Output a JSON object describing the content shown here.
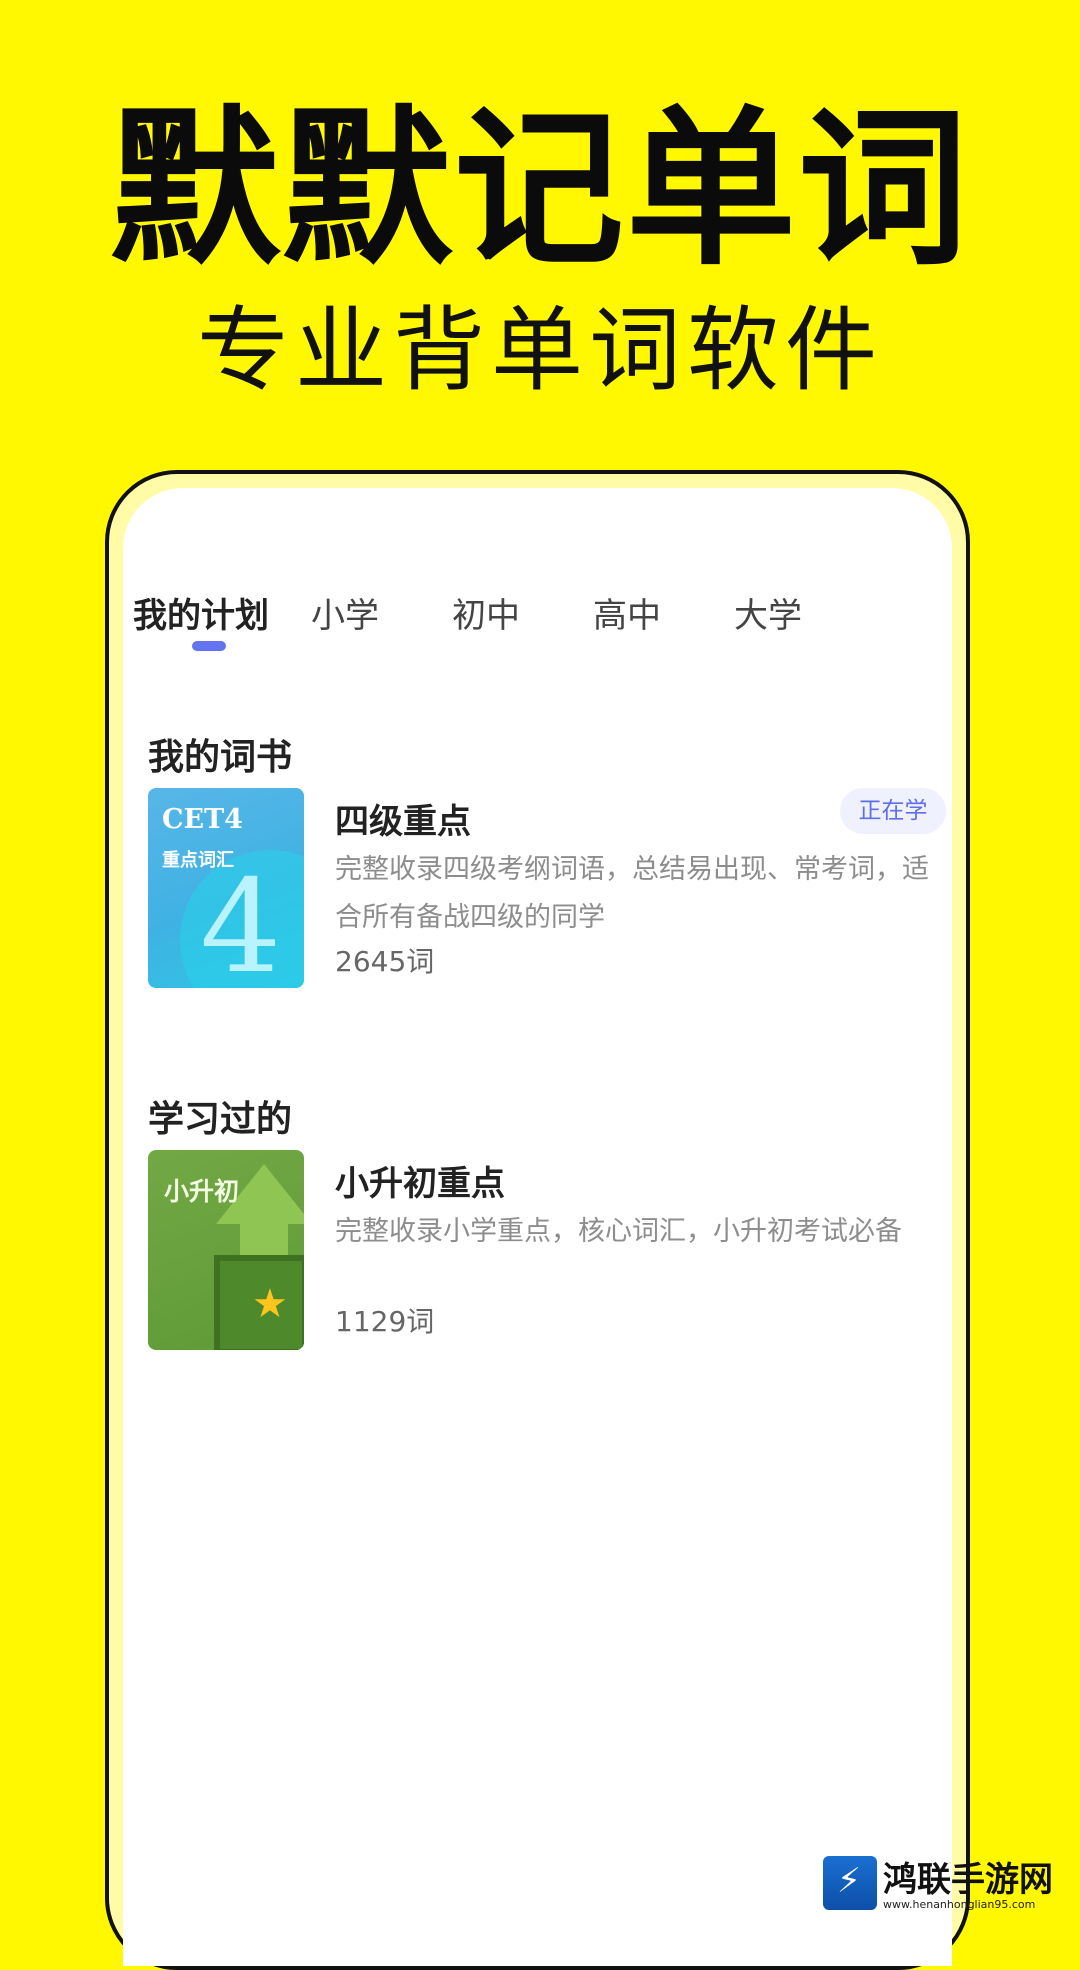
{
  "promo": {
    "headline": "默默记单词",
    "subheadline": "专业背单词软件"
  },
  "tabs": [
    {
      "label": "我的计划",
      "active": true
    },
    {
      "label": "小学",
      "active": false
    },
    {
      "label": "初中",
      "active": false
    },
    {
      "label": "高中",
      "active": false
    },
    {
      "label": "大学",
      "active": false
    }
  ],
  "my_books": {
    "title": "我的词书",
    "items": [
      {
        "cover_title": "CET4",
        "cover_subtitle": "重点词汇",
        "cover_number": "4",
        "title": "四级重点",
        "description": "完整收录四级考纲词语，总结易出现、常考词，适合所有备战四级的同学",
        "count": "2645词",
        "badge": "正在学"
      }
    ]
  },
  "studied": {
    "title": "学习过的",
    "items": [
      {
        "cover_title": "小升初",
        "title": "小升初重点",
        "description": "完整收录小学重点，核心词汇，小升初考试必备",
        "count": "1129词"
      }
    ]
  },
  "watermark": {
    "name": "鸿联手游网",
    "url": "www.henanhonglian95.com"
  },
  "colors": {
    "background": "#FFF800",
    "accent": "#6374F3",
    "badge_bg": "#EFF2FE"
  }
}
